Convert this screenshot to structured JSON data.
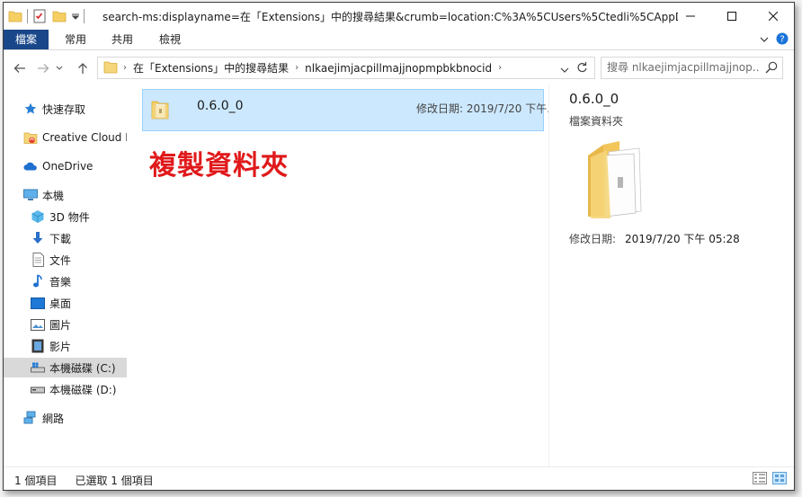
{
  "window": {
    "title": "search-ms:displayname=在「Extensions」中的搜尋結果&crumb=location:C%3A%5CUsers%5Ctedli%5CAppD...",
    "accent": "#19478a"
  },
  "ribbon": {
    "tabs": [
      "檔案",
      "常用",
      "共用",
      "檢視"
    ]
  },
  "address": {
    "crumbs": [
      "在「Extensions」中的搜尋結果",
      "nlkaejimjacpillmajjnopmpbkbnocid"
    ]
  },
  "search": {
    "placeholder": "搜尋 nlkaejimjacpillmajjnop..."
  },
  "sidebar": {
    "items": [
      {
        "label": "快速存取",
        "icon": "star-icon"
      },
      {
        "label": "Creative Cloud F",
        "icon": "creative-cloud-icon"
      },
      {
        "label": "OneDrive",
        "icon": "cloud-icon"
      },
      {
        "label": "本機",
        "icon": "computer-icon"
      },
      {
        "label": "3D 物件",
        "icon": "cube-icon"
      },
      {
        "label": "下載",
        "icon": "download-icon"
      },
      {
        "label": "文件",
        "icon": "document-icon"
      },
      {
        "label": "音樂",
        "icon": "music-icon"
      },
      {
        "label": "桌面",
        "icon": "desktop-icon"
      },
      {
        "label": "圖片",
        "icon": "picture-icon"
      },
      {
        "label": "影片",
        "icon": "video-icon"
      },
      {
        "label": "本機磁碟 (C:)",
        "icon": "drive-icon"
      },
      {
        "label": "本機磁碟 (D:)",
        "icon": "drive-icon"
      },
      {
        "label": "網路",
        "icon": "network-icon"
      }
    ],
    "selected": "本機磁碟 (C:)"
  },
  "files": [
    {
      "name": "0.6.0_0",
      "date": "修改日期: 2019/7/20 下午..."
    }
  ],
  "overlay_text": "複製資料夾",
  "details": {
    "name": "0.6.0_0",
    "type": "檔案資料夾",
    "modified_label": "修改日期:",
    "modified_value": "2019/7/20 下午 05:28"
  },
  "status": {
    "count": "1 個項目",
    "selected": "已選取 1 個項目"
  }
}
